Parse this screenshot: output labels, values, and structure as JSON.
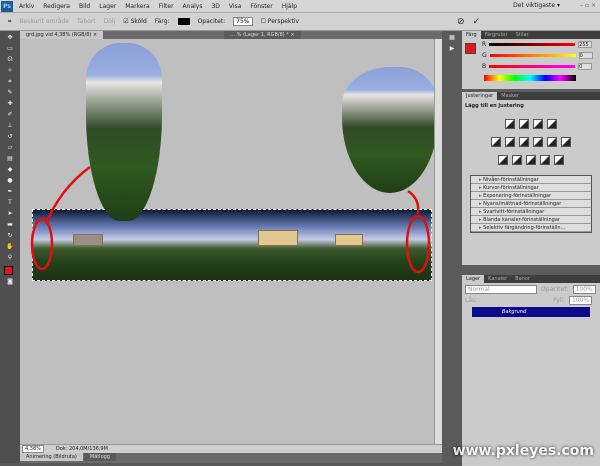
{
  "menubar": {
    "logo": "Ps",
    "items": [
      "Arkiv",
      "Redigera",
      "Bild",
      "Lager",
      "Markera",
      "Filter",
      "Analys",
      "3D",
      "Visa",
      "Fönster",
      "Hjälp"
    ],
    "workspace": "Det viktigaste ▾",
    "window_controls": "– ▫ ×"
  },
  "options": {
    "tool": "⌗",
    "resize": "Beskurit område",
    "hide": "Tabort",
    "hide2": "Dölj",
    "shield": "Sköld",
    "color_label": "Färg:",
    "opacity_label": "Opacitet:",
    "opacity": "75%",
    "perspective": "Perspektiv",
    "cancel": "⊘",
    "commit": "✓"
  },
  "tabs": [
    "grd.jpg vid 4,38% (RGB/8) ×",
    "… % (Lager 1, RGB/8) * ×"
  ],
  "status": {
    "zoom": "4,38%",
    "doc": "Dok: 204,0M/136,9M"
  },
  "bottom_tabs": [
    "Animering (Bildruta)",
    "Mätlogg"
  ],
  "color_panel": {
    "tabs": [
      "Färg",
      "Färgrutor",
      "Stilar"
    ],
    "r": "255",
    "g": "0",
    "b": "0",
    "fg": "#e8141c"
  },
  "adjust_panel": {
    "tabs": [
      "Justeringar",
      "Masker"
    ],
    "title": "Lägg till en justering",
    "presets": [
      "Nivåer-förinställningar",
      "Kurvor-förinställningar",
      "Exponering-förinställningar",
      "Nyans/mättnad-förinställningar",
      "Svartvitt-förinställningar",
      "Blanda kanaler-förinställningar",
      "Selektiv färgändring-förinställn..."
    ]
  },
  "layers_panel": {
    "tabs": [
      "Lager",
      "Kanaler",
      "Banor"
    ],
    "blend": "Normal",
    "opacity_label": "Opacitet:",
    "opacity": "100%",
    "lock_label": "Lås:",
    "fill_label": "Fyll:",
    "fill": "100%",
    "layer": "Bakgrund"
  },
  "watermark": "www.pxleyes.com"
}
